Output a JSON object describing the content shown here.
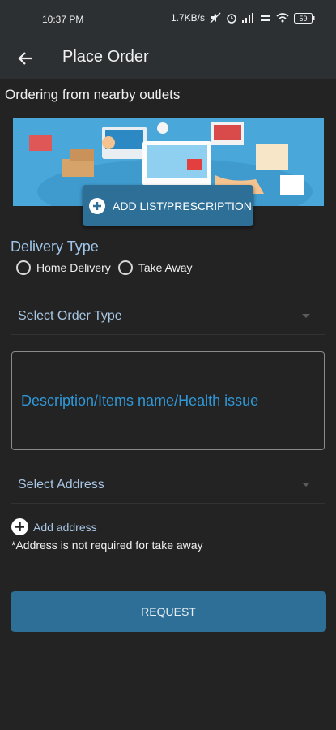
{
  "status_bar": {
    "time": "10:37 PM",
    "network_speed": "1.7KB/s",
    "battery": "59",
    "icons": [
      "screen-icon",
      "mute-icon",
      "alarm-icon",
      "signal-icon",
      "volte-wifi-icon",
      "wifi-icon",
      "battery-icon"
    ]
  },
  "app_bar": {
    "title": "Place Order",
    "back_icon": "arrow-left-icon"
  },
  "subtitle": "Ordering from nearby outlets",
  "banner": {
    "add_button_label": "ADD LIST/PRESCRIPTION"
  },
  "delivery": {
    "label": "Delivery Type",
    "options": [
      "Home Delivery",
      "Take Away"
    ]
  },
  "order_type": {
    "placeholder": "Select Order Type"
  },
  "description": {
    "placeholder": "Description/Items name/Health issue"
  },
  "address": {
    "placeholder": "Select Address",
    "add_label": "Add address",
    "note": "*Address is not required for take away"
  },
  "request_button": "REQUEST",
  "colors": {
    "background": "#232323",
    "app_bar": "#2d3033",
    "accent_button": "#2e6f97",
    "label_blue": "#9fc6ea",
    "placeholder_blue": "#2f98d8"
  }
}
